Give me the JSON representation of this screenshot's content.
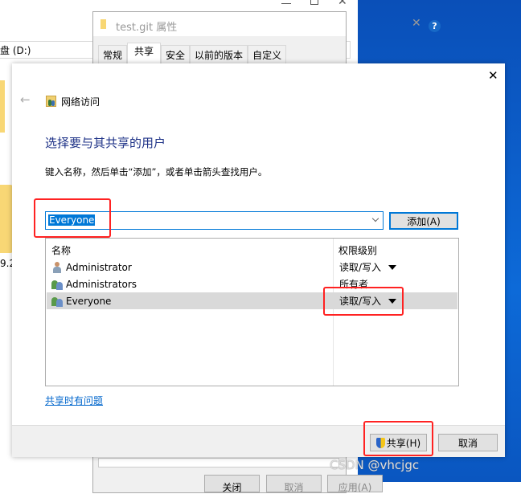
{
  "explorer": {
    "drive_label": "盘 (D:)",
    "partial_label": "9.2"
  },
  "properties": {
    "title": "test.git 属性",
    "tabs": [
      "常规",
      "共享",
      "安全",
      "以前的版本",
      "自定义"
    ],
    "active_tab": "共享",
    "bottom_buttons": [
      "关闭",
      "取消",
      "应用(A)"
    ]
  },
  "dialog": {
    "breadcrumb": "网络访问",
    "heading": "选择要与其共享的用户",
    "instruction": "键入名称，然后单击“添加”，或者单击箭头查找用户。",
    "input_value": "Everyone",
    "add_button": "添加(A)",
    "columns": {
      "name": "名称",
      "permission": "权限级别"
    },
    "users": [
      {
        "name": "Administrator",
        "permission": "读取/写入",
        "icon": "user-icon",
        "has_dropdown": true,
        "selected": false
      },
      {
        "name": "Administrators",
        "permission": "所有者",
        "icon": "group-icon",
        "has_dropdown": false,
        "selected": false
      },
      {
        "name": "Everyone",
        "permission": "读取/写入",
        "icon": "group-icon",
        "has_dropdown": true,
        "selected": true
      }
    ],
    "help_link": "共享时有问题",
    "share_button": "共享(H)",
    "cancel_button": "取消"
  },
  "watermark": "CSDN @vhcjgc",
  "colors": {
    "accent": "#0078d7",
    "heading": "#1e3287",
    "highlight_box": "#ff2222",
    "selected_row": "#d9d9d9"
  }
}
